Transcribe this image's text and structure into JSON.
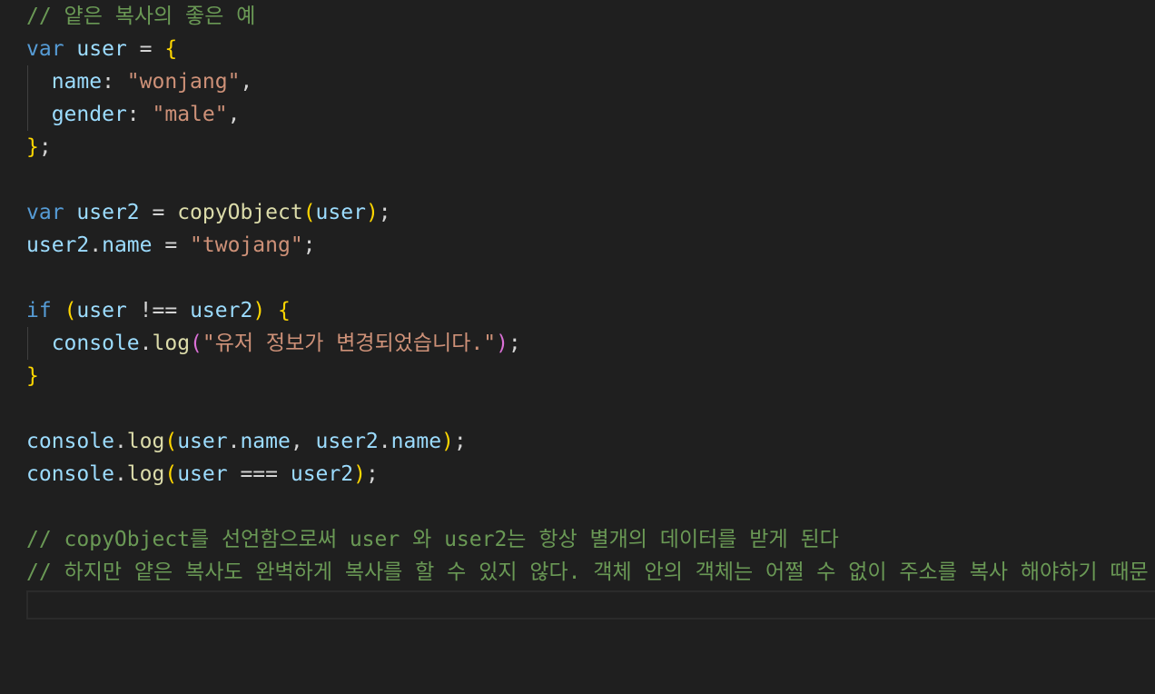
{
  "editor": {
    "lines": [
      [
        {
          "t": "// 얕은 복사의 좋은 예",
          "c": "comment"
        }
      ],
      [
        {
          "t": "var",
          "c": "keyword"
        },
        {
          "t": " ",
          "c": "punct"
        },
        {
          "t": "user",
          "c": "var"
        },
        {
          "t": " = ",
          "c": "punct"
        },
        {
          "t": "{",
          "c": "brace"
        }
      ],
      [
        {
          "t": "  ",
          "c": "punct"
        },
        {
          "t": "name",
          "c": "var"
        },
        {
          "t": ": ",
          "c": "punct"
        },
        {
          "t": "\"wonjang\"",
          "c": "string"
        },
        {
          "t": ",",
          "c": "punct"
        }
      ],
      [
        {
          "t": "  ",
          "c": "punct"
        },
        {
          "t": "gender",
          "c": "var"
        },
        {
          "t": ": ",
          "c": "punct"
        },
        {
          "t": "\"male\"",
          "c": "string"
        },
        {
          "t": ",",
          "c": "punct"
        }
      ],
      [
        {
          "t": "}",
          "c": "brace"
        },
        {
          "t": ";",
          "c": "punct"
        }
      ],
      [],
      [
        {
          "t": "var",
          "c": "keyword"
        },
        {
          "t": " ",
          "c": "punct"
        },
        {
          "t": "user2",
          "c": "var"
        },
        {
          "t": " = ",
          "c": "punct"
        },
        {
          "t": "copyObject",
          "c": "fn"
        },
        {
          "t": "(",
          "c": "brace"
        },
        {
          "t": "user",
          "c": "var"
        },
        {
          "t": ")",
          "c": "brace"
        },
        {
          "t": ";",
          "c": "punct"
        }
      ],
      [
        {
          "t": "user2",
          "c": "var"
        },
        {
          "t": ".",
          "c": "punct"
        },
        {
          "t": "name",
          "c": "var"
        },
        {
          "t": " = ",
          "c": "punct"
        },
        {
          "t": "\"twojang\"",
          "c": "string"
        },
        {
          "t": ";",
          "c": "punct"
        }
      ],
      [],
      [
        {
          "t": "if",
          "c": "keyword"
        },
        {
          "t": " ",
          "c": "punct"
        },
        {
          "t": "(",
          "c": "brace"
        },
        {
          "t": "user",
          "c": "var"
        },
        {
          "t": " !== ",
          "c": "punct"
        },
        {
          "t": "user2",
          "c": "var"
        },
        {
          "t": ")",
          "c": "brace"
        },
        {
          "t": " ",
          "c": "punct"
        },
        {
          "t": "{",
          "c": "brace"
        }
      ],
      [
        {
          "t": "  ",
          "c": "punct"
        },
        {
          "t": "console",
          "c": "var"
        },
        {
          "t": ".",
          "c": "punct"
        },
        {
          "t": "log",
          "c": "fn"
        },
        {
          "t": "(",
          "c": "paren2"
        },
        {
          "t": "\"유저 정보가 변경되었습니다.\"",
          "c": "string"
        },
        {
          "t": ")",
          "c": "paren2"
        },
        {
          "t": ";",
          "c": "punct"
        }
      ],
      [
        {
          "t": "}",
          "c": "brace"
        }
      ],
      [],
      [
        {
          "t": "console",
          "c": "var"
        },
        {
          "t": ".",
          "c": "punct"
        },
        {
          "t": "log",
          "c": "fn"
        },
        {
          "t": "(",
          "c": "brace"
        },
        {
          "t": "user",
          "c": "var"
        },
        {
          "t": ".",
          "c": "punct"
        },
        {
          "t": "name",
          "c": "var"
        },
        {
          "t": ", ",
          "c": "punct"
        },
        {
          "t": "user2",
          "c": "var"
        },
        {
          "t": ".",
          "c": "punct"
        },
        {
          "t": "name",
          "c": "var"
        },
        {
          "t": ")",
          "c": "brace"
        },
        {
          "t": ";",
          "c": "punct"
        }
      ],
      [
        {
          "t": "console",
          "c": "var"
        },
        {
          "t": ".",
          "c": "punct"
        },
        {
          "t": "log",
          "c": "fn"
        },
        {
          "t": "(",
          "c": "brace"
        },
        {
          "t": "user",
          "c": "var"
        },
        {
          "t": " === ",
          "c": "punct"
        },
        {
          "t": "user2",
          "c": "var"
        },
        {
          "t": ")",
          "c": "brace"
        },
        {
          "t": ";",
          "c": "punct"
        }
      ],
      [],
      [
        {
          "t": "// copyObject를 선언함으로써 user 와 user2는 항상 별개의 데이터를 받게 된다",
          "c": "comment"
        }
      ],
      [
        {
          "t": "// 하지만 얕은 복사도 완벽하게 복사를 할 수 있지 않다. 객체 안의 객체는 어쩔 수 없이 주소를 복사 해야하기 때문",
          "c": "comment"
        }
      ]
    ]
  },
  "colors": {
    "background": "#1f1f1f",
    "keyword": "#569cd6",
    "variable": "#9cdcfe",
    "function": "#dcdcaa",
    "string": "#ce9178",
    "comment": "#6a9955",
    "bracket": "#ffd700",
    "bracket_nested": "#da70d6"
  }
}
